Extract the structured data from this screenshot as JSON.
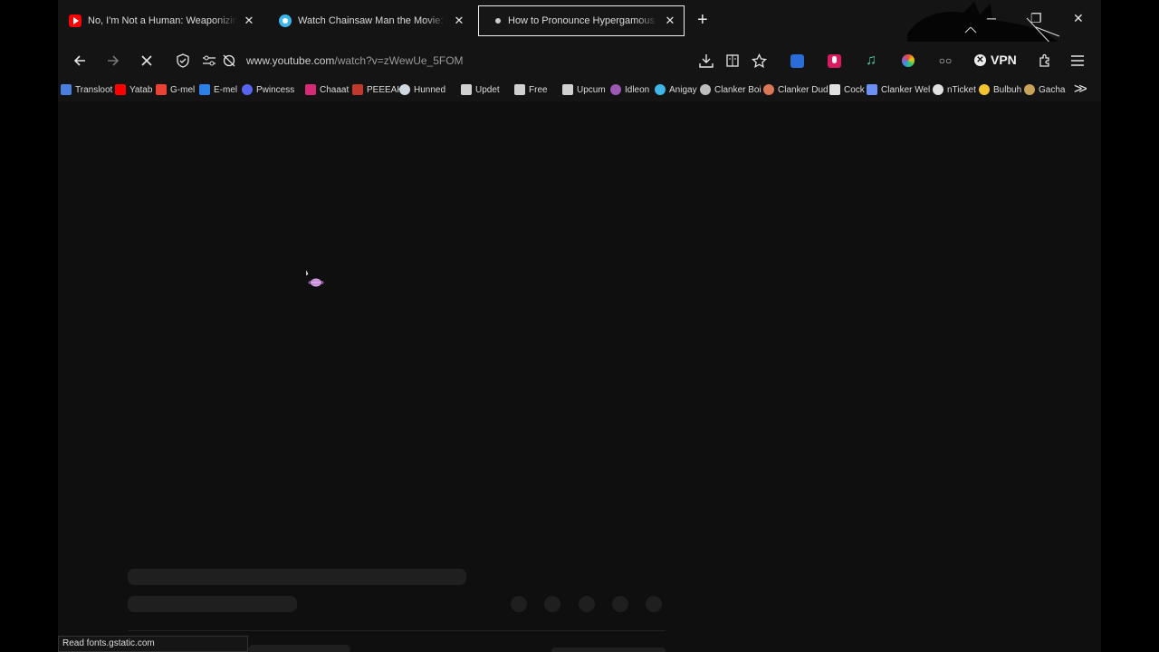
{
  "tabs": [
    {
      "title": "No, I'm Not a Human: Weaponizing Tr",
      "favicon": "youtube-icon",
      "color": "#ff0000",
      "active": false
    },
    {
      "title": "Watch Chainsaw Man the Movie: Reze",
      "favicon": "site-icon",
      "color": "#3fb6e8",
      "active": false
    },
    {
      "title": "How to Pronounce Hypergamous - Yo",
      "favicon": "loading-dot-icon",
      "color": "#cccccc",
      "active": true
    }
  ],
  "address_bar": {
    "url_host": "www.youtube.com",
    "url_path": "/watch?v=zWewUe_5FOM"
  },
  "toolbar": {
    "vpn_label": "VPN"
  },
  "bookmarks": [
    {
      "label": "Transloot",
      "icon": "translate-icon",
      "color": "#4a7fe0"
    },
    {
      "label": "Yatab",
      "icon": "youtube-icon",
      "color": "#ff0000"
    },
    {
      "label": "G-mel",
      "icon": "gmail-icon",
      "color": "#ea4335"
    },
    {
      "label": "E-mel",
      "icon": "mail-icon",
      "color": "#2f7fe8"
    },
    {
      "label": "Pwincess",
      "icon": "discord-icon",
      "color": "#5865f2"
    },
    {
      "label": "Chaaat",
      "icon": "instagram-icon",
      "color": "#d62976"
    },
    {
      "label": "PEEEAK",
      "icon": "book-icon",
      "color": "#c0392b"
    },
    {
      "label": "Hunned",
      "icon": "steam-icon",
      "color": "#cfd8e0"
    },
    {
      "label": "Updet",
      "icon": "stack-icon",
      "color": "#d0d0d0"
    },
    {
      "label": "Free",
      "icon": "stack-icon",
      "color": "#d0d0d0"
    },
    {
      "label": "Upcum",
      "icon": "stack-icon",
      "color": "#d0d0d0"
    },
    {
      "label": "Idleon",
      "icon": "idleon-icon",
      "color": "#9b59b6"
    },
    {
      "label": "Anigay",
      "icon": "anime-icon",
      "color": "#3fb6e8"
    },
    {
      "label": "Clanker Boi",
      "icon": "openai-icon",
      "color": "#bdbdbd"
    },
    {
      "label": "Clanker Dud",
      "icon": "claude-icon",
      "color": "#d97757"
    },
    {
      "label": "Cock",
      "icon": "x-logo-icon",
      "color": "#e0e0e0"
    },
    {
      "label": "Clanker Wel",
      "icon": "gemini-icon",
      "color": "#6d8ef5"
    },
    {
      "label": "nTicket",
      "icon": "globe-icon",
      "color": "#e0e0e0"
    },
    {
      "label": "Bulbuh",
      "icon": "lightbulb-icon",
      "color": "#f4c430"
    },
    {
      "label": "Gacha",
      "icon": "sun-icon",
      "color": "#c8a25a"
    }
  ],
  "status_bar": {
    "text": "Read fonts.gstatic.com"
  },
  "colors": {
    "background": "#0f0f0f",
    "chrome": "#141414",
    "skeleton": "#1f1f1f",
    "active_tab_border": "#f0f0f0"
  }
}
